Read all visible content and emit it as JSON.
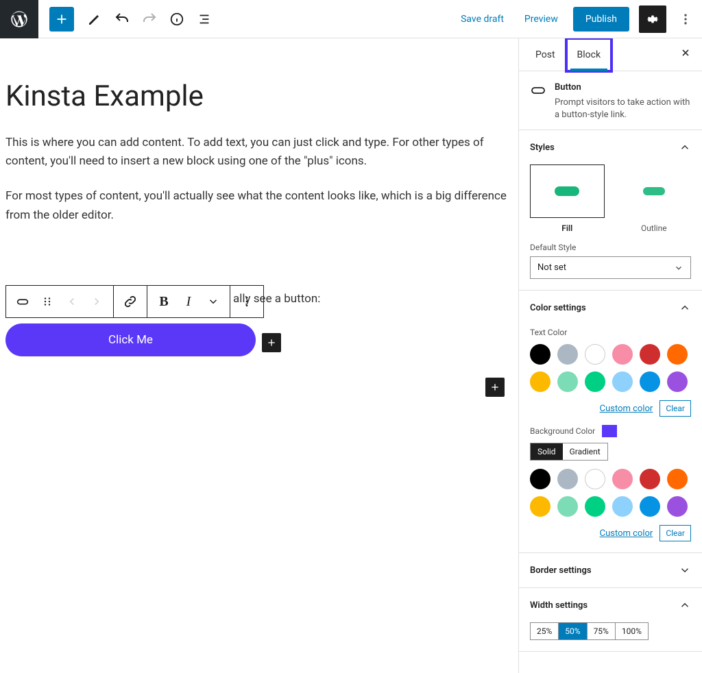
{
  "toolbar": {
    "save_draft": "Save draft",
    "preview": "Preview",
    "publish": "Publish"
  },
  "editor": {
    "title": "Kinsta Example",
    "para1": "This is where you can add content. To add text, you can just click and type. For other types of content, you'll need to insert a new block using one of the \"plus\" icons.",
    "para2": "For most types of content, you'll actually see what the content looks like, which is a big difference from the older editor.",
    "trail": "ally see a button:",
    "button_text": "Click Me"
  },
  "sidebar": {
    "tabs": {
      "post": "Post",
      "block": "Block"
    },
    "block_title": "Button",
    "block_desc": "Prompt visitors to take action with a button-style link.",
    "styles": {
      "header": "Styles",
      "fill": "Fill",
      "outline": "Outline",
      "default_style_label": "Default Style",
      "default_style_value": "Not set"
    },
    "color": {
      "header": "Color settings",
      "text_label": "Text Color",
      "bg_label": "Background Color",
      "tab_solid": "Solid",
      "tab_gradient": "Gradient",
      "custom": "Custom color",
      "clear": "Clear",
      "bg_value": "#5b38f7",
      "palette": [
        "#000000",
        "#abb8c3",
        "#ffffff",
        "#f78da7",
        "#cf2e2e",
        "#ff6900",
        "#fcb900",
        "#7bdcb5",
        "#00d084",
        "#8ed1fc",
        "#0693e3",
        "#9b51e0"
      ]
    },
    "border": {
      "header": "Border settings"
    },
    "width": {
      "header": "Width settings",
      "options": [
        "25%",
        "50%",
        "75%",
        "100%"
      ],
      "selected": "50%"
    }
  }
}
